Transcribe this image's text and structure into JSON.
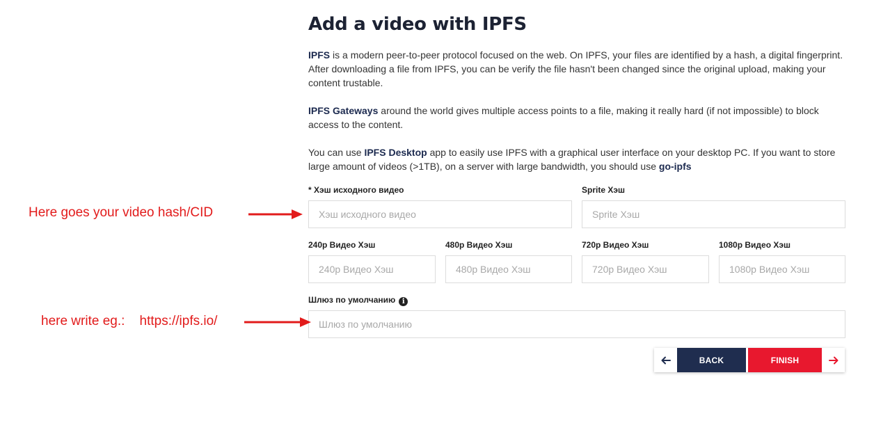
{
  "page": {
    "title": "Add a video with IPFS",
    "intro": {
      "p1_bold": "IPFS",
      "p1_text": " is a modern peer-to-peer protocol focused on the web. On IPFS, your files are identified by a hash, a digital fingerprint. After downloading a file from IPFS, you can be verify the file hasn't been changed since the original upload, making your content trustable.",
      "p2_bold": "IPFS Gateways",
      "p2_text": " around the world gives multiple access points to a file, making it really hard (if not impossible) to block access to the content.",
      "p3_text_a": "You can use ",
      "p3_bold_a": "IPFS Desktop",
      "p3_text_b": " app to easily use IPFS with a graphical user interface on your desktop PC. If you want to store large amount of videos (>1TB), on a server with large bandwidth, you should use ",
      "p3_bold_b": "go-ipfs"
    }
  },
  "form": {
    "source_hash": {
      "label": "* Хэш исходного видео",
      "placeholder": "Хэш исходного видео",
      "value": ""
    },
    "sprite_hash": {
      "label": "Sprite Хэш",
      "placeholder": "Sprite Хэш",
      "value": ""
    },
    "hash_240": {
      "label": "240p Видео Хэш",
      "placeholder": "240p Видео Хэш",
      "value": ""
    },
    "hash_480": {
      "label": "480p Видео Хэш",
      "placeholder": "480p Видео Хэш",
      "value": ""
    },
    "hash_720": {
      "label": "720p Видео Хэш",
      "placeholder": "720p Видео Хэш",
      "value": ""
    },
    "hash_1080": {
      "label": "1080p Видео Хэш",
      "placeholder": "1080p Видео Хэш",
      "value": ""
    },
    "gateway": {
      "label": "Шлюз по умолчанию",
      "placeholder": "Шлюз по умолчанию",
      "value": "",
      "info_icon": "info-icon"
    }
  },
  "buttons": {
    "back_arrow_icon": "arrow-left-icon",
    "back_label": "BACK",
    "finish_label": "FINISH",
    "finish_arrow_icon": "arrow-right-icon"
  },
  "annotations": {
    "hash_note": "Here goes your video hash/CID",
    "gateway_note": "here write eg.:    https://ipfs.io/"
  },
  "colors": {
    "accent_red": "#e8182e",
    "navy": "#1f2d4f",
    "annotation_red": "#e21b1b"
  }
}
